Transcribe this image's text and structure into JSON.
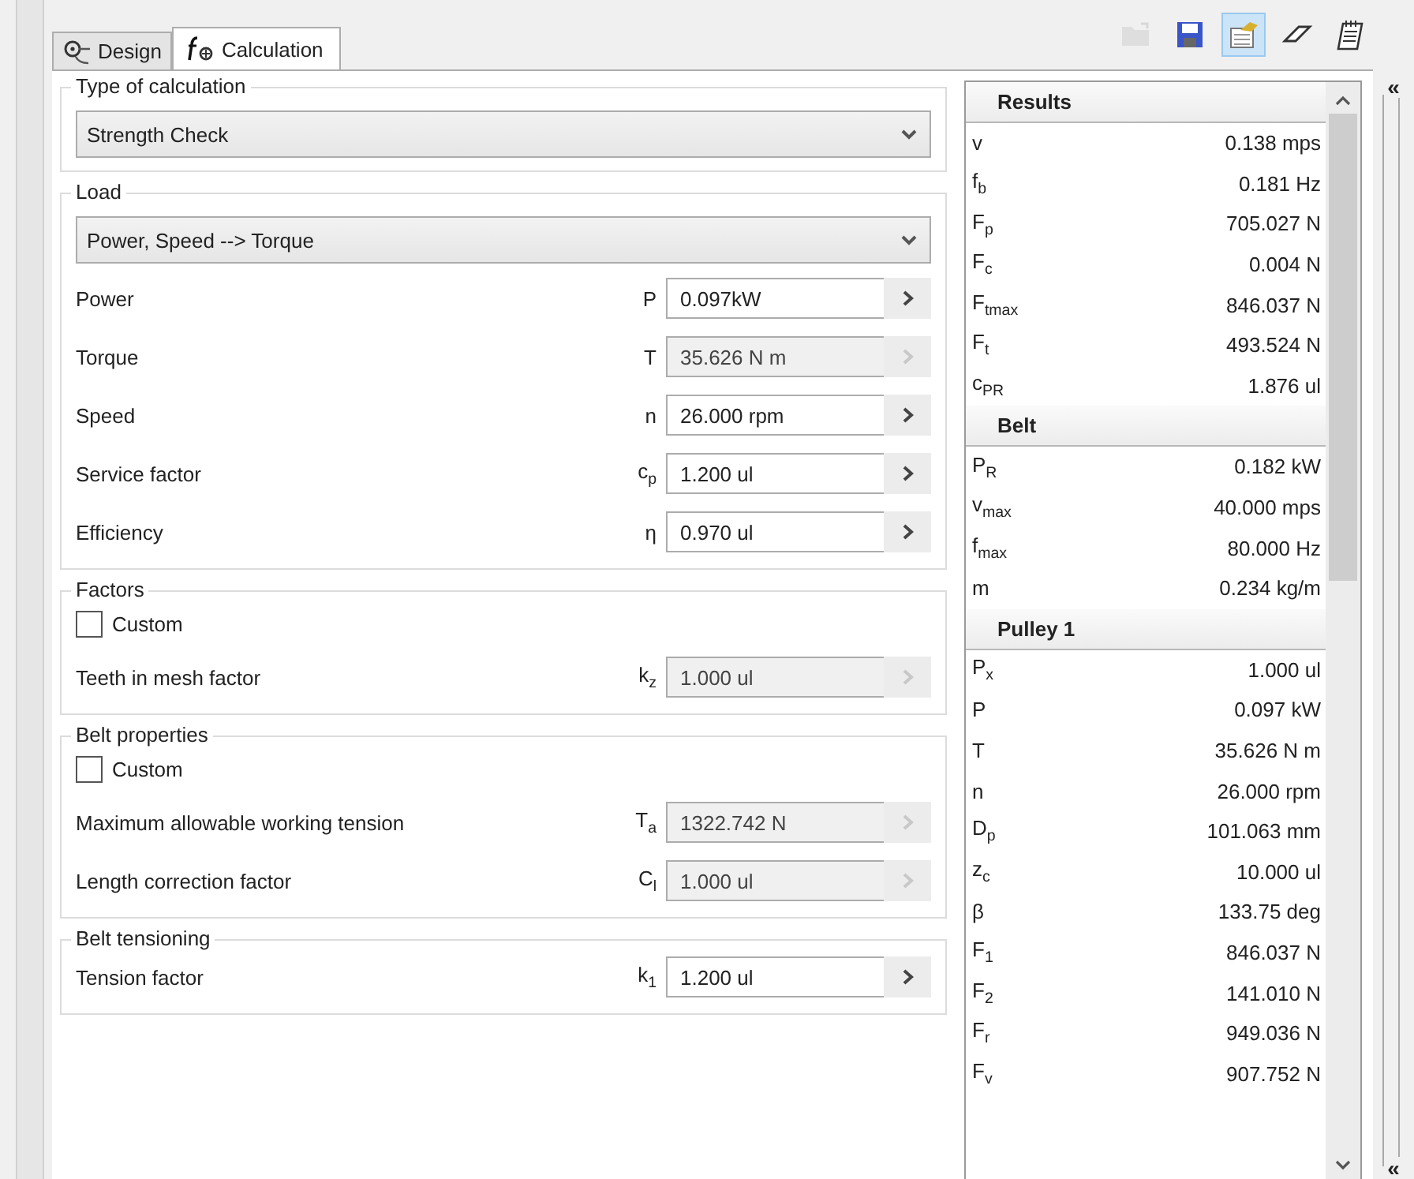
{
  "tabs": [
    {
      "label": "Design",
      "kind": "design",
      "selected": false
    },
    {
      "label": "Calculation",
      "kind": "calc",
      "selected": true
    }
  ],
  "toolbar": [
    {
      "kind": "folder",
      "disabled": true,
      "selected": false
    },
    {
      "kind": "save",
      "disabled": false,
      "selected": false
    },
    {
      "kind": "properties",
      "disabled": false,
      "selected": true
    },
    {
      "kind": "eraser",
      "disabled": false,
      "selected": false
    },
    {
      "kind": "notepad",
      "disabled": false,
      "selected": false
    }
  ],
  "sections": [
    {
      "title": "Type of calculation",
      "items": [
        {
          "kind": "dropdown",
          "value": "Strength Check"
        }
      ]
    },
    {
      "title": "Load",
      "items": [
        {
          "kind": "dropdown",
          "value": "Power, Speed --> Torque"
        },
        {
          "kind": "field",
          "label": "Power",
          "symbol": "P",
          "value": "0.097kW",
          "disabled": false
        },
        {
          "kind": "field",
          "label": "Torque",
          "symbol": "T",
          "value": "35.626 N m",
          "disabled": true
        },
        {
          "kind": "field",
          "label": "Speed",
          "symbol": "n",
          "value": "26.000 rpm",
          "disabled": false
        },
        {
          "kind": "field",
          "label": "Service factor",
          "symbol": "c$_{p}$",
          "value": "1.200 ul",
          "disabled": false
        },
        {
          "kind": "field",
          "label": "Efficiency",
          "symbol": "η",
          "value": "0.970 ul",
          "disabled": false
        }
      ]
    },
    {
      "title": "Factors",
      "items": [
        {
          "kind": "checkbox",
          "label": "Custom",
          "checked": false
        },
        {
          "kind": "field",
          "label": "Teeth in mesh factor",
          "symbol": "k$_{z}$",
          "value": "1.000 ul",
          "disabled": true
        }
      ]
    },
    {
      "title": "Belt properties",
      "items": [
        {
          "kind": "checkbox",
          "label": "Custom",
          "checked": false
        },
        {
          "kind": "field",
          "label": "Maximum allowable working tension",
          "symbol": "T$_{a}$",
          "value": "1322.742 N",
          "disabled": true
        },
        {
          "kind": "field",
          "label": "Length correction factor",
          "symbol": "C$_{l}$",
          "value": "1.000 ul",
          "disabled": true
        }
      ]
    },
    {
      "title": "Belt tensioning",
      "items": [
        {
          "kind": "field",
          "label": "Tension factor",
          "symbol": "k$_{1}$",
          "value": "1.200 ul",
          "disabled": false
        }
      ]
    }
  ],
  "results": [
    {
      "title": "Results",
      "rows": [
        {
          "symbol": "v",
          "value": "0.138 mps"
        },
        {
          "symbol": "f$_{b}$",
          "value": "0.181 Hz"
        },
        {
          "symbol": "F$_{p}$",
          "value": "705.027 N"
        },
        {
          "symbol": "F$_{c}$",
          "value": "0.004 N"
        },
        {
          "symbol": "F$_{tmax}$",
          "value": "846.037 N"
        },
        {
          "symbol": "F$_{t}$",
          "value": "493.524 N"
        },
        {
          "symbol": "c$_{PR}$",
          "value": "1.876 ul"
        }
      ]
    },
    {
      "title": "Belt",
      "rows": [
        {
          "symbol": "P$_{R}$",
          "value": "0.182 kW"
        },
        {
          "symbol": "v$_{max}$",
          "value": "40.000 mps"
        },
        {
          "symbol": "f$_{max}$",
          "value": "80.000 Hz"
        },
        {
          "symbol": "m",
          "value": "0.234 kg/m"
        }
      ]
    },
    {
      "title": "Pulley 1",
      "rows": [
        {
          "symbol": "P$_{x}$",
          "value": "1.000 ul"
        },
        {
          "symbol": "P",
          "value": "0.097 kW"
        },
        {
          "symbol": "T",
          "value": "35.626 N m"
        },
        {
          "symbol": "n",
          "value": "26.000 rpm"
        },
        {
          "symbol": "D$_{p}$",
          "value": "101.063 mm"
        },
        {
          "symbol": "z$_{c}$",
          "value": "10.000 ul"
        },
        {
          "symbol": "β",
          "value": "133.75 deg"
        },
        {
          "symbol": "F$_{1}$",
          "value": "846.037 N"
        },
        {
          "symbol": "F$_{2}$",
          "value": "141.010 N"
        },
        {
          "symbol": "F$_{r}$",
          "value": "949.036 N"
        },
        {
          "symbol": "F$_{v}$",
          "value": "907.752 N"
        }
      ]
    }
  ],
  "collapse_buttons": [
    "«",
    "«"
  ]
}
